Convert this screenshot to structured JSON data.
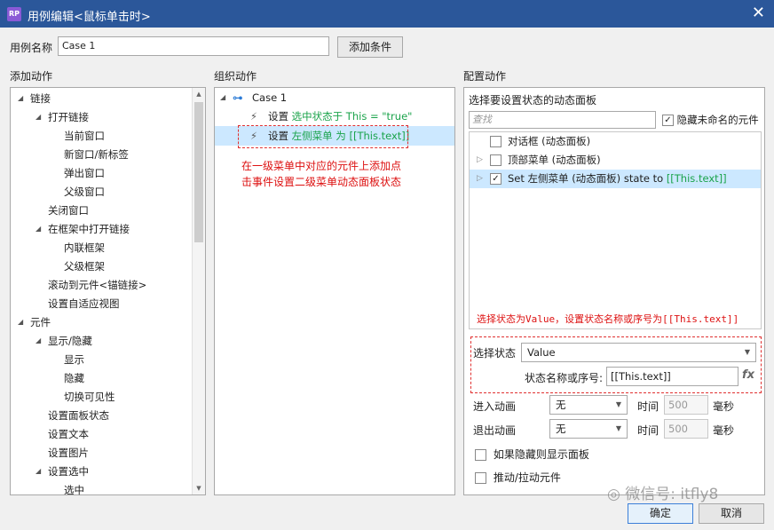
{
  "window": {
    "app_icon": "RP",
    "title": "用例编辑<鼠标单击时>",
    "close": "✕"
  },
  "case": {
    "label": "用例名称",
    "value": "Case 1",
    "add_condition": "添加条件"
  },
  "sections": {
    "add_action": "添加动作",
    "organize_action": "组织动作",
    "configure_action": "配置动作"
  },
  "add_actions": [
    {
      "label": "链接",
      "indent": 0,
      "tri": "◢"
    },
    {
      "label": "打开链接",
      "indent": 1,
      "tri": "◢"
    },
    {
      "label": "当前窗口",
      "indent": 2,
      "tri": ""
    },
    {
      "label": "新窗口/新标签",
      "indent": 2,
      "tri": ""
    },
    {
      "label": "弹出窗口",
      "indent": 2,
      "tri": ""
    },
    {
      "label": "父级窗口",
      "indent": 2,
      "tri": ""
    },
    {
      "label": "关闭窗口",
      "indent": 1,
      "tri": ""
    },
    {
      "label": "在框架中打开链接",
      "indent": 1,
      "tri": "◢"
    },
    {
      "label": "内联框架",
      "indent": 2,
      "tri": ""
    },
    {
      "label": "父级框架",
      "indent": 2,
      "tri": ""
    },
    {
      "label": "滚动到元件<锚链接>",
      "indent": 1,
      "tri": ""
    },
    {
      "label": "设置自适应视图",
      "indent": 1,
      "tri": ""
    },
    {
      "label": "元件",
      "indent": 0,
      "tri": "◢"
    },
    {
      "label": "显示/隐藏",
      "indent": 1,
      "tri": "◢"
    },
    {
      "label": "显示",
      "indent": 2,
      "tri": ""
    },
    {
      "label": "隐藏",
      "indent": 2,
      "tri": ""
    },
    {
      "label": "切换可见性",
      "indent": 2,
      "tri": ""
    },
    {
      "label": "设置面板状态",
      "indent": 1,
      "tri": ""
    },
    {
      "label": "设置文本",
      "indent": 1,
      "tri": ""
    },
    {
      "label": "设置图片",
      "indent": 1,
      "tri": ""
    },
    {
      "label": "设置选中",
      "indent": 1,
      "tri": "◢"
    },
    {
      "label": "选中",
      "indent": 2,
      "tri": ""
    }
  ],
  "organize": {
    "case_name": "Case 1",
    "actions": [
      {
        "prefix": "设置 ",
        "detail": "选中状态于 This = \"true\""
      },
      {
        "prefix": "设置 ",
        "detail": "左侧菜单 为 [[This.text]]"
      }
    ],
    "annotation_line1": "在一级菜单中对应的元件上添加点",
    "annotation_line2": "击事件设置二级菜单动态面板状态"
  },
  "configure": {
    "panel_title": "选择要设置状态的动态面板",
    "search_placeholder": "查找",
    "hide_unnamed_label": "隐藏未命名的元件",
    "hide_unnamed_checked": "✓",
    "panels": [
      {
        "name": "对话框 (动态面板)",
        "checked": "",
        "has_tri": false,
        "selected": false
      },
      {
        "name": "顶部菜单 (动态面板)",
        "checked": "",
        "has_tri": true,
        "selected": false
      },
      {
        "name": "Set 左侧菜单 (动态面板) state to ",
        "value": "[[This.text]]",
        "checked": "✓",
        "has_tri": true,
        "selected": true
      }
    ],
    "hint": "选择状态为Value，设置状态名称或序号为[[This.text]]",
    "state_label": "选择状态",
    "state_value": "Value",
    "state_name_label": "状态名称或序号:",
    "state_name_value": "[[This.text]]",
    "fx": "fx",
    "enter_anim_label": "进入动画",
    "enter_anim_value": "无",
    "exit_anim_label": "退出动画",
    "exit_anim_value": "无",
    "time_label": "时间",
    "time_value": "500",
    "ms_label": "毫秒",
    "show_if_hidden": "如果隐藏则显示面板",
    "push_pull": "推动/拉动元件"
  },
  "watermark": "微信号: itfly8",
  "buttons": {
    "ok": "确定",
    "cancel": "取消"
  }
}
